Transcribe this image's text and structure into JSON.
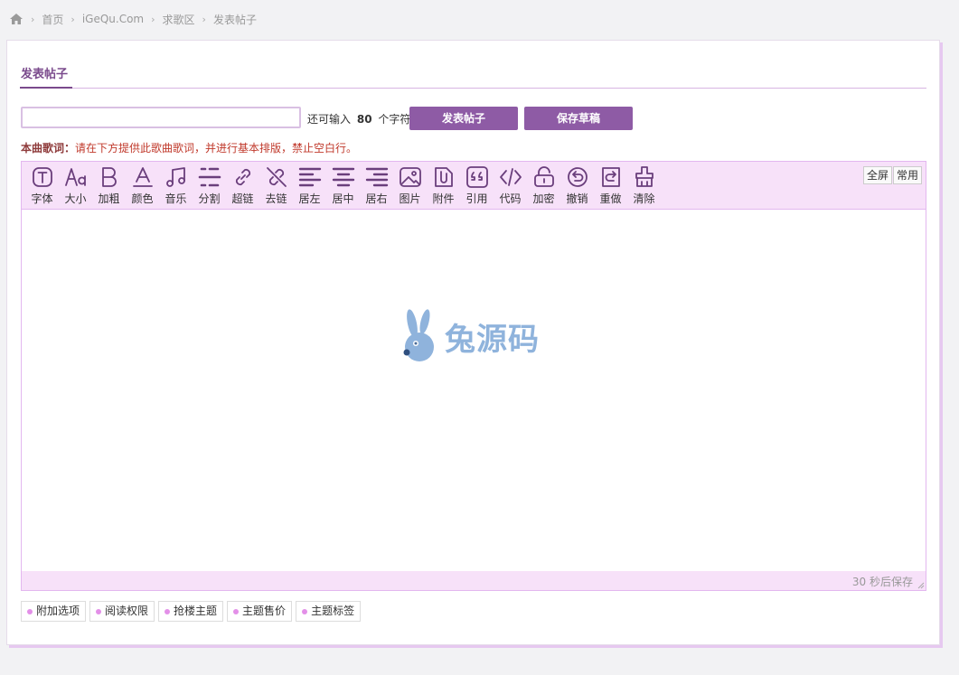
{
  "breadcrumb": {
    "items": [
      "首页",
      "iGeQu.Com",
      "求歌区",
      "发表帖子"
    ]
  },
  "tab": {
    "title": "发表帖子"
  },
  "subject": {
    "value": "",
    "remain_prefix": "还可输入",
    "remain_count": "80",
    "remain_suffix": "个字符"
  },
  "buttons": {
    "post": "发表帖子",
    "draft": "保存草稿"
  },
  "lyric_tip": {
    "label": "本曲歌词：",
    "message": "请在下方提供此歌曲歌词，并进行基本排版，禁止空白行。"
  },
  "toolbar": {
    "items": [
      {
        "label": "字体",
        "icon": "font-icon"
      },
      {
        "label": "大小",
        "icon": "font-size-icon"
      },
      {
        "label": "加粗",
        "icon": "bold-icon"
      },
      {
        "label": "颜色",
        "icon": "font-color-icon"
      },
      {
        "label": "音乐",
        "icon": "music-icon"
      },
      {
        "label": "分割",
        "icon": "divider-icon"
      },
      {
        "label": "超链",
        "icon": "link-icon"
      },
      {
        "label": "去链",
        "icon": "unlink-icon"
      },
      {
        "label": "居左",
        "icon": "align-left-icon"
      },
      {
        "label": "居中",
        "icon": "align-center-icon"
      },
      {
        "label": "居右",
        "icon": "align-right-icon"
      },
      {
        "label": "图片",
        "icon": "image-icon"
      },
      {
        "label": "附件",
        "icon": "attachment-icon"
      },
      {
        "label": "引用",
        "icon": "quote-icon"
      },
      {
        "label": "代码",
        "icon": "code-icon"
      },
      {
        "label": "加密",
        "icon": "lock-icon"
      },
      {
        "label": "撤销",
        "icon": "undo-icon"
      },
      {
        "label": "重做",
        "icon": "redo-icon"
      },
      {
        "label": "清除",
        "icon": "clear-format-icon"
      }
    ],
    "fullscreen": "全屏",
    "common": "常用"
  },
  "watermark": {
    "text": "兔源码"
  },
  "status": {
    "autosave": "30 秒后保存"
  },
  "options": [
    "附加选项",
    "阅读权限",
    "抢楼主题",
    "主题售价",
    "主题标签"
  ],
  "colors": {
    "accent": "#8e5ba5",
    "toolbar_bg": "#f7e1f9",
    "border": "#e3b7ef",
    "icon": "#6a3e7c"
  }
}
